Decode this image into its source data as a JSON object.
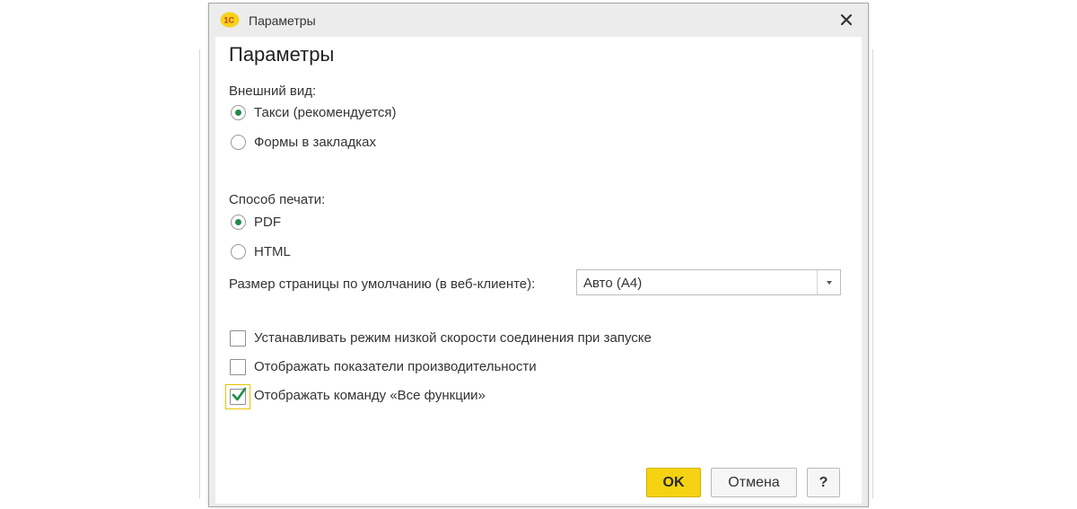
{
  "window": {
    "title": "Параметры",
    "app_logo_text": "1С"
  },
  "content": {
    "heading": "Параметры",
    "appearance": {
      "label": "Внешний вид:",
      "options": [
        {
          "label": "Такси (рекомендуется)",
          "selected": true
        },
        {
          "label": "Формы в закладках",
          "selected": false
        }
      ]
    },
    "print_method": {
      "label": "Способ печати:",
      "options": [
        {
          "label": "PDF",
          "selected": true
        },
        {
          "label": "HTML",
          "selected": false
        }
      ]
    },
    "page_size": {
      "label": "Размер страницы по умолчанию (в веб-клиенте):",
      "value": "Авто (А4)"
    },
    "checkboxes": [
      {
        "label": "Устанавливать режим низкой скорости соединения при запуске",
        "checked": false
      },
      {
        "label": "Отображать показатели производительности",
        "checked": false
      },
      {
        "label": "Отображать команду «Все функции»",
        "checked": true
      }
    ]
  },
  "buttons": {
    "ok": "OK",
    "cancel": "Отмена",
    "help": "?"
  },
  "colors": {
    "accent": "#f5d312",
    "radio_dot": "#1f8c4a",
    "checkmark": "#1f8c4a"
  }
}
